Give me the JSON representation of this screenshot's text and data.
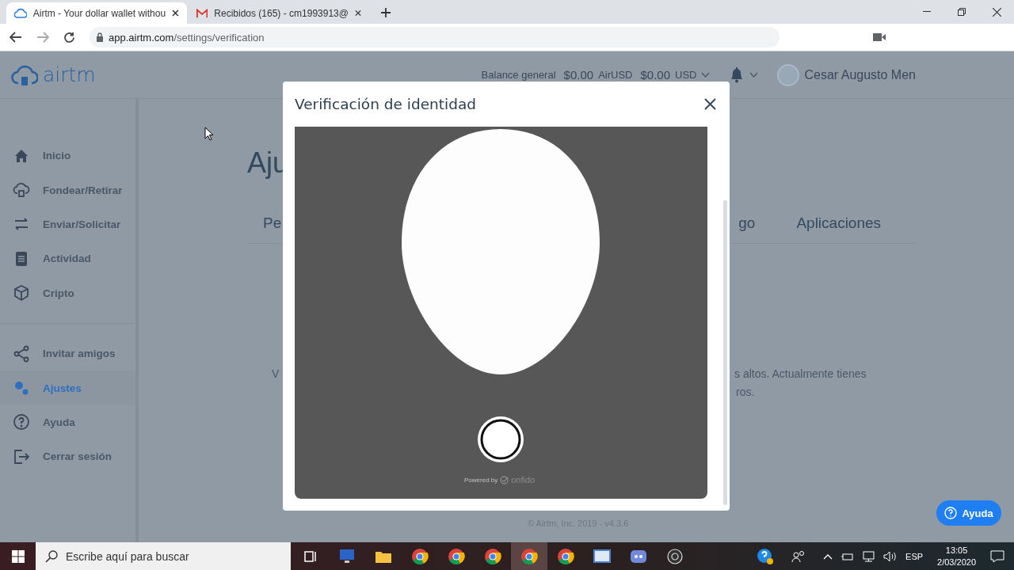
{
  "browser": {
    "tabs": [
      {
        "title": "Airtm - Your dollar wallet withou",
        "selected": true
      },
      {
        "title": "Recibidos (165) - cm1993913@",
        "selected": false
      }
    ],
    "url_host": "app.airtm.com",
    "url_path": "/settings/verification"
  },
  "header": {
    "logo": "airtm",
    "balance_label": "Balance general",
    "balances": [
      {
        "amount": "$0.00",
        "currency": "AirUSD"
      },
      {
        "amount": "$0.00",
        "currency": "USD"
      }
    ],
    "user": "Cesar Augusto Men"
  },
  "sidebar": {
    "sections": [
      {
        "items": [
          {
            "label": "Inicio",
            "selected": false
          },
          {
            "label": "Fondear/Retirar",
            "selected": false
          },
          {
            "label": "Enviar/Solicitar",
            "selected": false
          },
          {
            "label": "Actividad",
            "selected": false
          },
          {
            "label": "Cripto",
            "selected": false
          }
        ]
      },
      {
        "items": [
          {
            "label": "Invitar amigos",
            "selected": false
          },
          {
            "label": "Ajustes",
            "selected": true
          },
          {
            "label": "Ayuda",
            "selected": false
          },
          {
            "label": "Cerrar sesión",
            "selected": false
          }
        ]
      }
    ]
  },
  "main": {
    "heading": "Aju",
    "tabs": [
      {
        "label": "Pe"
      },
      {
        "label": "go"
      },
      {
        "label": "Aplicaciones"
      }
    ],
    "text_fragments": [
      "V",
      "s altos. Actualmente tienes",
      "ros."
    ],
    "footer": "© Airtm, Inc. 2019 - v4.3.6"
  },
  "modal": {
    "title": "Verificación de identidad",
    "powered_by": "Powered by",
    "brand": "onfido"
  },
  "help_button": "Ayuda",
  "taskbar": {
    "search_placeholder": "Escribe aquí para buscar",
    "language": "ESP",
    "time": "13:05",
    "date": "2/03/2020"
  }
}
